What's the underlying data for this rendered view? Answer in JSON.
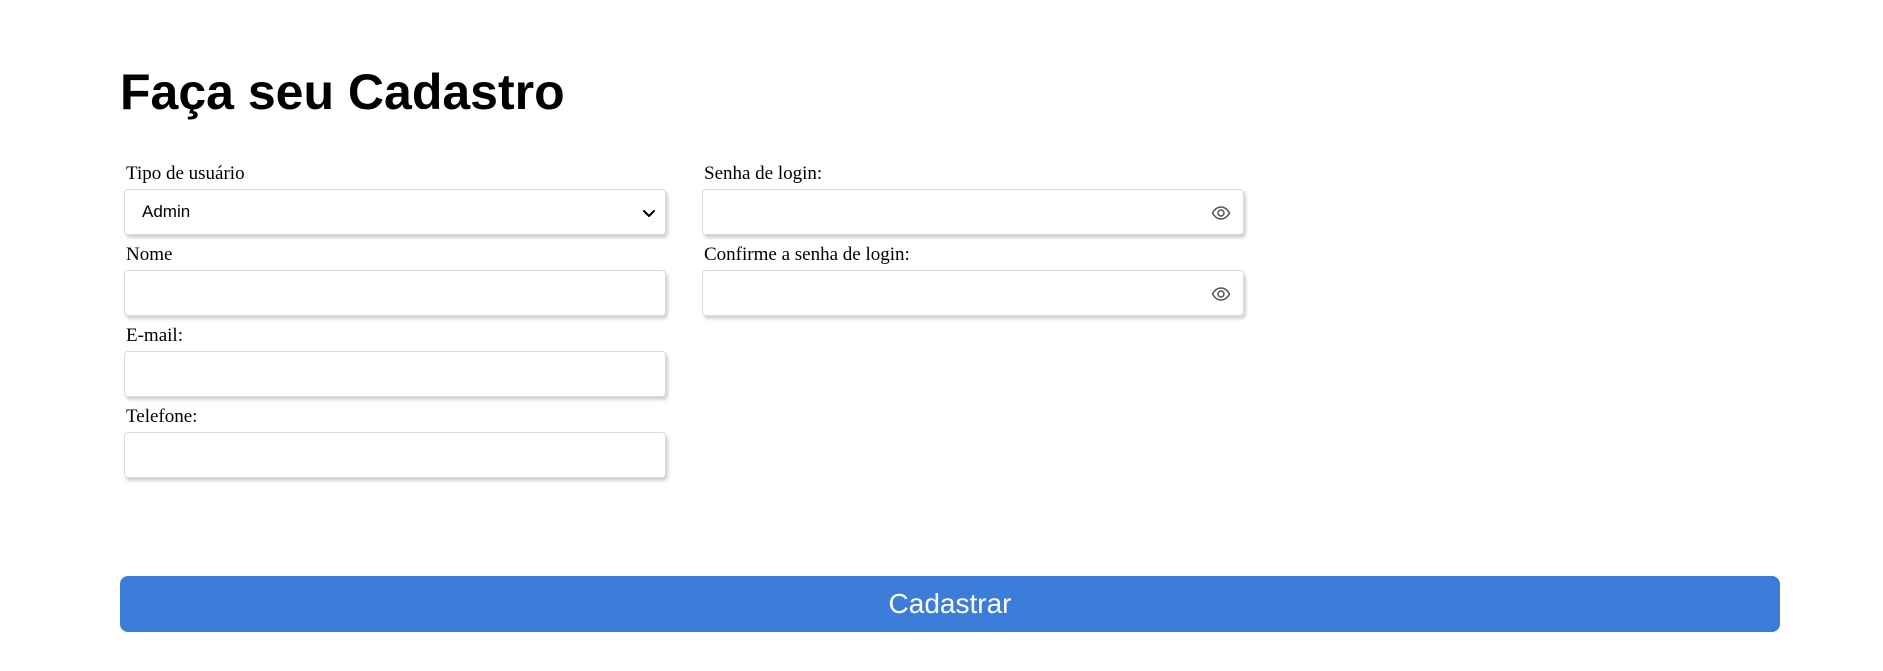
{
  "page": {
    "title": "Faça seu Cadastro"
  },
  "form": {
    "left_column": {
      "user_type": {
        "label": "Tipo de usuário",
        "value": "Admin"
      },
      "name": {
        "label": "Nome",
        "value": ""
      },
      "email": {
        "label": "E-mail:",
        "value": ""
      },
      "phone": {
        "label": "Telefone:",
        "value": ""
      }
    },
    "right_column": {
      "password": {
        "label": "Senha de login:",
        "value": "",
        "toggle_icon": "eye-icon"
      },
      "confirm_password": {
        "label": "Confirme a senha de login:",
        "value": "",
        "toggle_icon": "eye-icon"
      }
    },
    "submit_label": "Cadastrar"
  },
  "colors": {
    "accent": "#3b7dd8",
    "input_border": "#dadada"
  }
}
